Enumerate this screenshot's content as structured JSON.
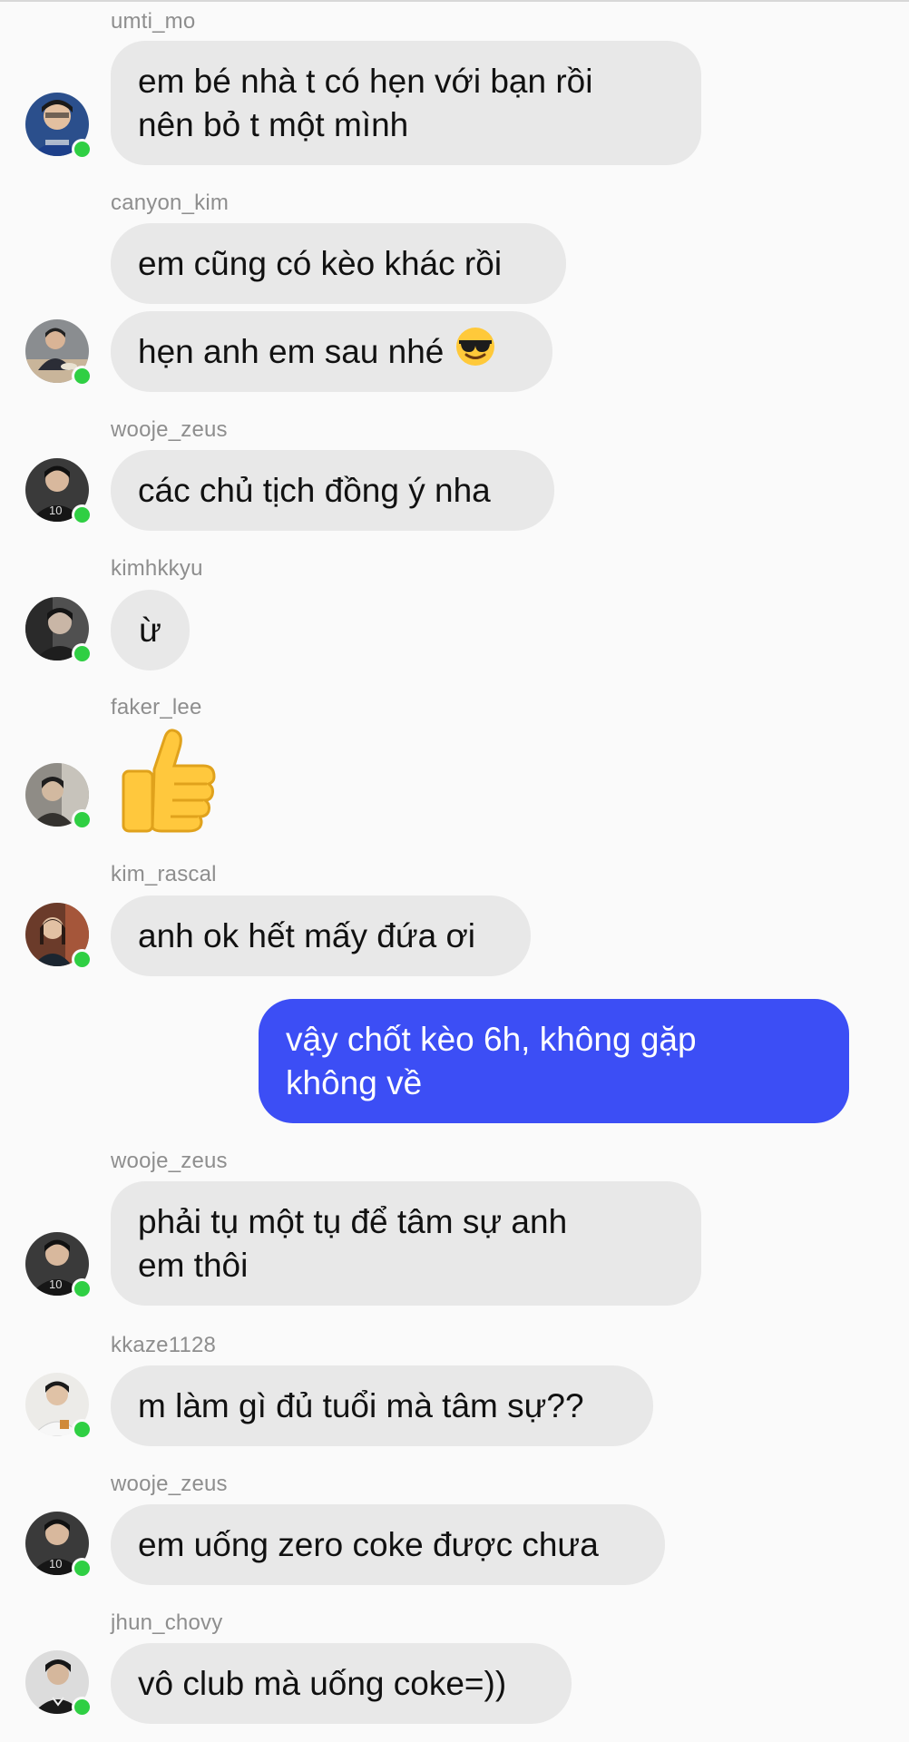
{
  "conversation": [
    {
      "sender": "umti_mo",
      "messages": [
        "em bé nhà t có hẹn với bạn rồi\nnên bỏ t một mình"
      ]
    },
    {
      "sender": "canyon_kim",
      "messages": [
        "em cũng có kèo khác rồi",
        "hẹn anh em sau nhé"
      ]
    },
    {
      "sender": "wooje_zeus",
      "messages": [
        "các chủ tịch đồng ý nha"
      ]
    },
    {
      "sender": "kimhkkyu",
      "messages": [
        "ừ"
      ]
    },
    {
      "sender": "faker_lee",
      "messages": [
        "thumbs-up-emoji"
      ]
    },
    {
      "sender": "kim_rascal",
      "messages": [
        "anh ok hết mấy đứa ơi"
      ]
    },
    {
      "sender": "me",
      "messages": [
        "vậy chốt kèo 6h, không gặp\nkhông về"
      ]
    },
    {
      "sender": "wooje_zeus",
      "messages": [
        "phải tụ một tụ để tâm sự anh\nem thôi"
      ]
    },
    {
      "sender": "kkaze1128",
      "messages": [
        "m làm gì đủ tuổi mà tâm sự??"
      ]
    },
    {
      "sender": "wooje_zeus",
      "messages": [
        "em uống zero coke được chưa"
      ]
    },
    {
      "sender": "jhun_chovy",
      "messages": [
        "vô club mà uống coke=))"
      ]
    }
  ],
  "icons": {
    "cool": "smiling-face-with-sunglasses-icon",
    "thumbs": "thumbs-up-icon",
    "online": "online-status-icon"
  },
  "colors": {
    "bubble_incoming": "#e8e8e8",
    "bubble_outgoing": "#3c4ef5",
    "username": "#8e8e8e",
    "online_dot": "#2fcf43",
    "background": "#fafafa"
  }
}
